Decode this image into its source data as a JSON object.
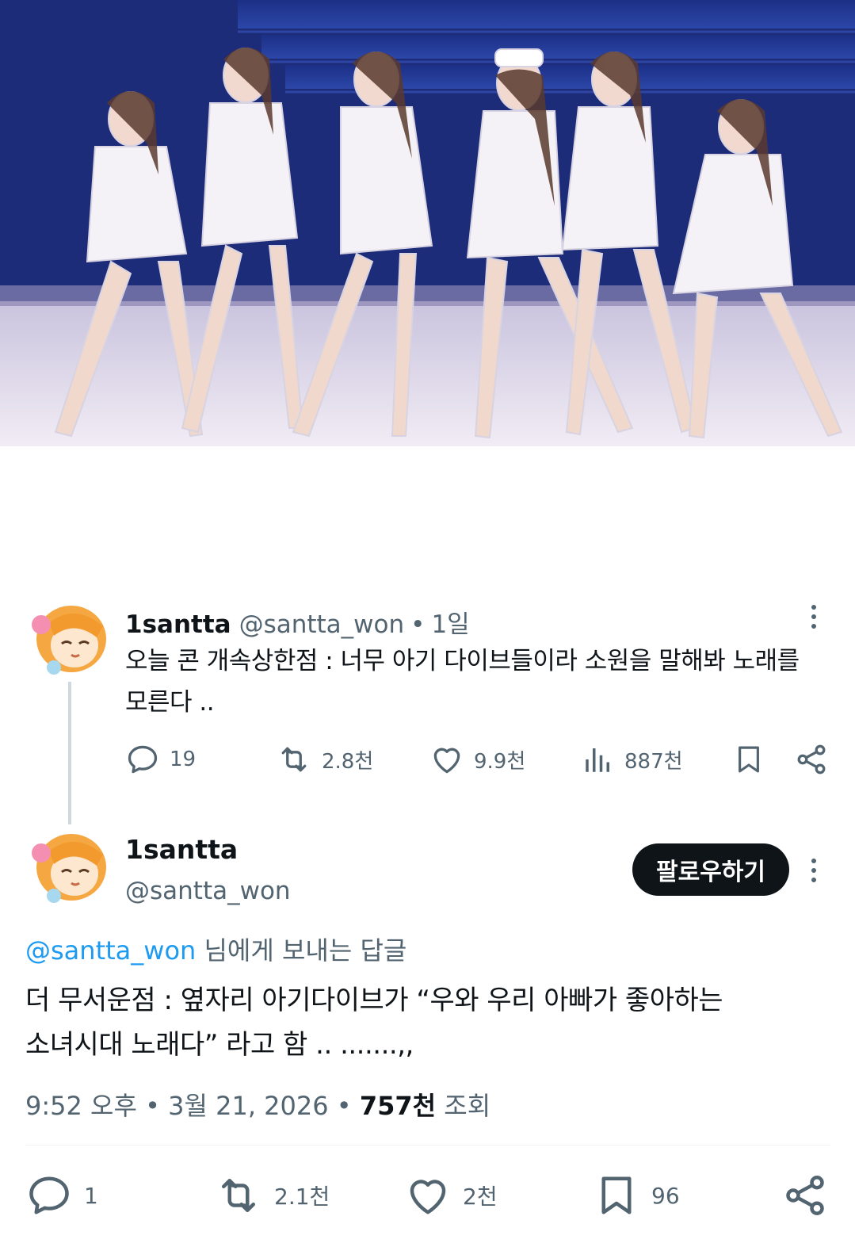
{
  "photo": {
    "description_icon": "photo-image"
  },
  "tweet1": {
    "name": "1santta",
    "handle": "@santta_won",
    "separator": "•",
    "time": "1일",
    "text_line1": "오늘 콘 개속상한점 : 너무 아기 다이브들이라 소원을 말해봐 노래를",
    "text_line2": "모른다 ..",
    "replies": "19",
    "retweets": "2.8천",
    "likes": "9.9천",
    "views": "887천"
  },
  "tweet2": {
    "name": "1santta",
    "handle": "@santta_won",
    "follow_label": "팔로우하기",
    "reply_mention": "@santta_won",
    "reply_suffix": " 님에게 보내는 답글",
    "text_line1": "더 무서운점 : 옆자리 아기다이브가 “우와 우리 아빠가 좋아하는",
    "text_line2": "소녀시대 노래다” 라고 함 .. .......,,",
    "time": "9:52 오후",
    "separator": "•",
    "date": "3월 21, 2026",
    "views_count": "757천",
    "views_label": "조회",
    "replies": "1",
    "retweets": "2.1천",
    "likes": "2천",
    "bookmarks": "96"
  },
  "colors": {
    "text_primary": "#0f1419",
    "text_secondary": "#536471",
    "link": "#1d9bf0",
    "follow_bg": "#0f1419",
    "avatar_hair": "#f5a742"
  }
}
